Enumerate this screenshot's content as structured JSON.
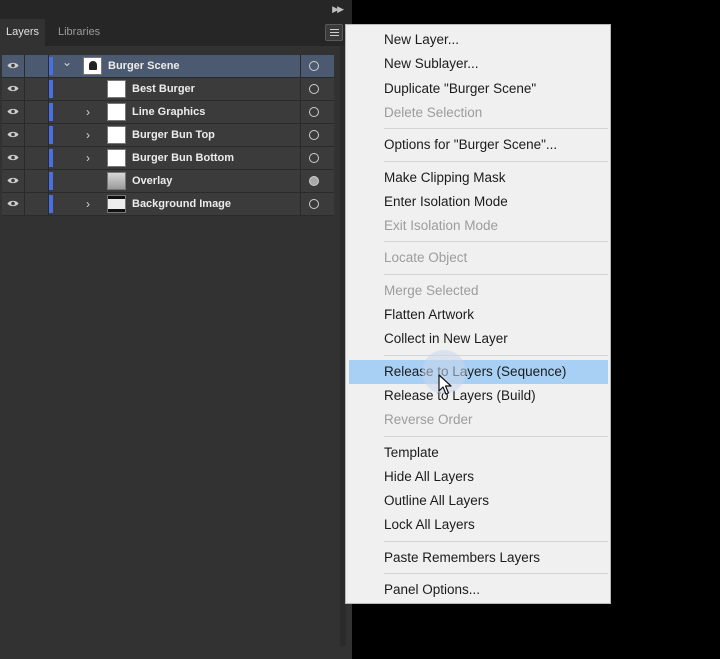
{
  "panel": {
    "tabs": [
      {
        "label": "Layers",
        "active": true
      },
      {
        "label": "Libraries",
        "active": false
      }
    ],
    "layers": [
      {
        "name": "Burger Scene",
        "level": 0,
        "expanded": true,
        "has_children": true,
        "selected": true,
        "target_filled": false
      },
      {
        "name": "Best Burger",
        "level": 1,
        "has_children": false,
        "selected": false,
        "target_filled": false
      },
      {
        "name": "Line Graphics",
        "level": 1,
        "has_children": true,
        "selected": false,
        "target_filled": false
      },
      {
        "name": "Burger Bun Top",
        "level": 1,
        "has_children": true,
        "selected": false,
        "target_filled": false
      },
      {
        "name": "Burger Bun Bottom",
        "level": 1,
        "has_children": true,
        "selected": false,
        "target_filled": false
      },
      {
        "name": "Overlay",
        "level": 1,
        "has_children": false,
        "selected": false,
        "target_filled": true
      },
      {
        "name": "Background Image",
        "level": 1,
        "has_children": true,
        "selected": false,
        "target_filled": false
      }
    ],
    "layer_color": "#4a6fe0"
  },
  "menu": {
    "groups": [
      [
        {
          "label": "New Layer...",
          "enabled": true
        },
        {
          "label": "New Sublayer...",
          "enabled": true
        },
        {
          "label": "Duplicate \"Burger Scene\"",
          "enabled": true
        },
        {
          "label": "Delete Selection",
          "enabled": false
        }
      ],
      [
        {
          "label": "Options for \"Burger Scene\"...",
          "enabled": true
        }
      ],
      [
        {
          "label": "Make Clipping Mask",
          "enabled": true
        },
        {
          "label": "Enter Isolation Mode",
          "enabled": true
        },
        {
          "label": "Exit Isolation Mode",
          "enabled": false
        }
      ],
      [
        {
          "label": "Locate Object",
          "enabled": false
        }
      ],
      [
        {
          "label": "Merge Selected",
          "enabled": false
        },
        {
          "label": "Flatten Artwork",
          "enabled": true
        },
        {
          "label": "Collect in New Layer",
          "enabled": true
        }
      ],
      [
        {
          "label": "Release to Layers (Sequence)",
          "enabled": true,
          "highlighted": true
        },
        {
          "label": "Release to Layers (Build)",
          "enabled": true
        },
        {
          "label": "Reverse Order",
          "enabled": false
        }
      ],
      [
        {
          "label": "Template",
          "enabled": true
        },
        {
          "label": "Hide All Layers",
          "enabled": true
        },
        {
          "label": "Outline All Layers",
          "enabled": true
        },
        {
          "label": "Lock All Layers",
          "enabled": true
        }
      ],
      [
        {
          "label": "Paste Remembers Layers",
          "enabled": true
        }
      ],
      [
        {
          "label": "Panel Options...",
          "enabled": true
        }
      ]
    ],
    "highlight_color": "#a8d0f5"
  },
  "icons": {
    "visibility": "eye-icon",
    "collapse": "double-chevron-right-icon",
    "panel_menu": "hamburger-icon",
    "cursor": "mouse-pointer-icon"
  }
}
